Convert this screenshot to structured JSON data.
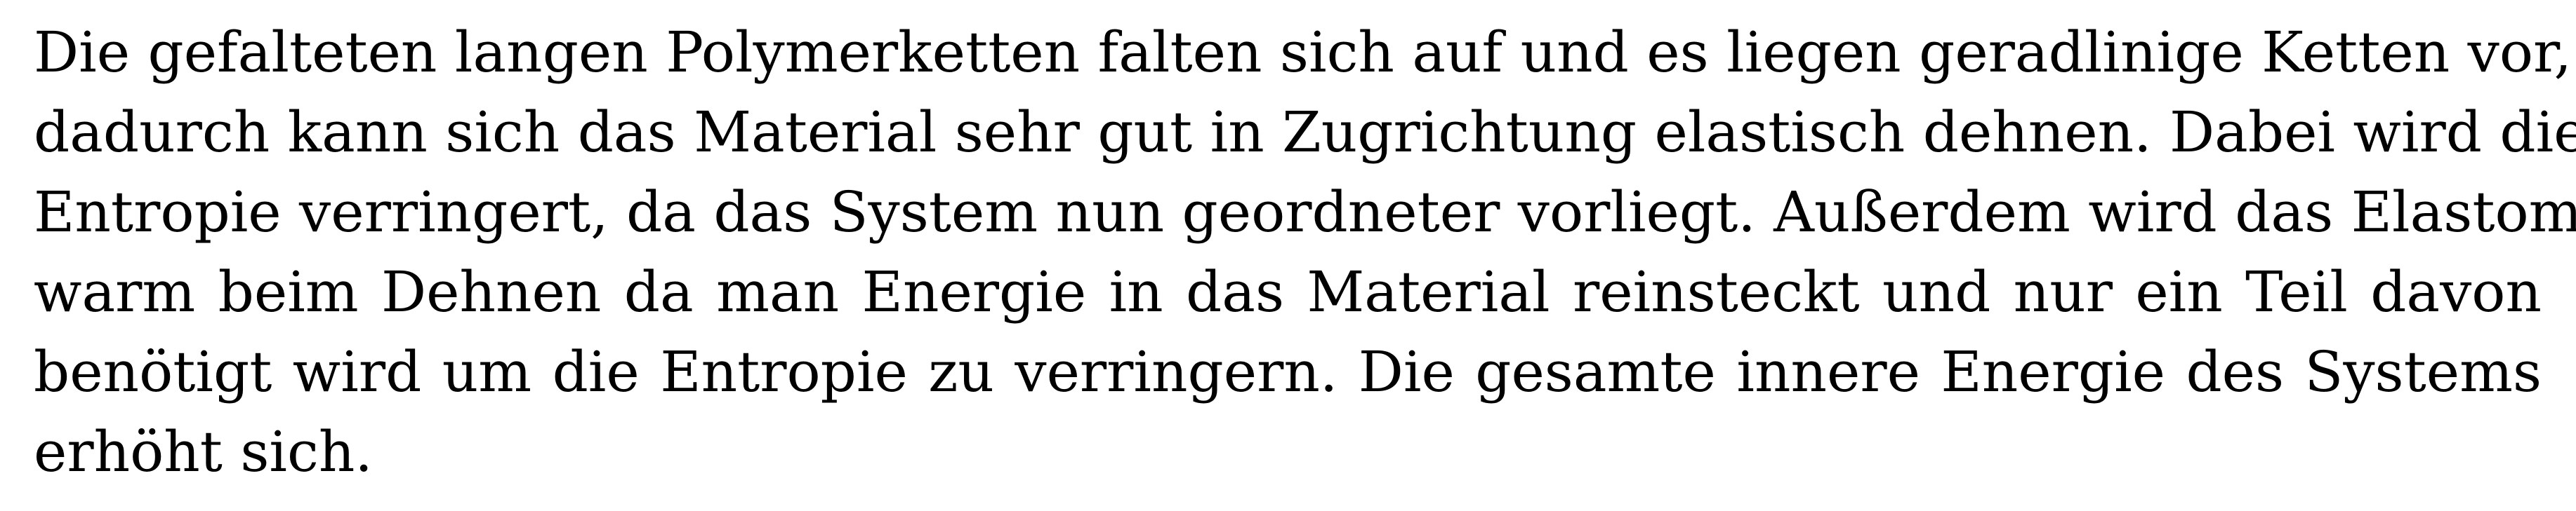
{
  "document": {
    "paragraph_lines": [
      "Die gefalteten langen Polymerketten falten sich auf und es liegen geradlinige Ketten vor,",
      "dadurch kann sich das Material sehr gut in Zugrichtung elastisch dehnen. Dabei wird die",
      "Entropie verringert, da das System nun geordneter vorliegt. Außerdem wird das Elastomer",
      "warm beim Dehnen da man Energie in das Material reinsteckt und nur ein Teil davon",
      "benötigt wird um die Entropie zu verringern. Die gesamte innere Energie des Systems",
      "erhöht sich."
    ]
  }
}
